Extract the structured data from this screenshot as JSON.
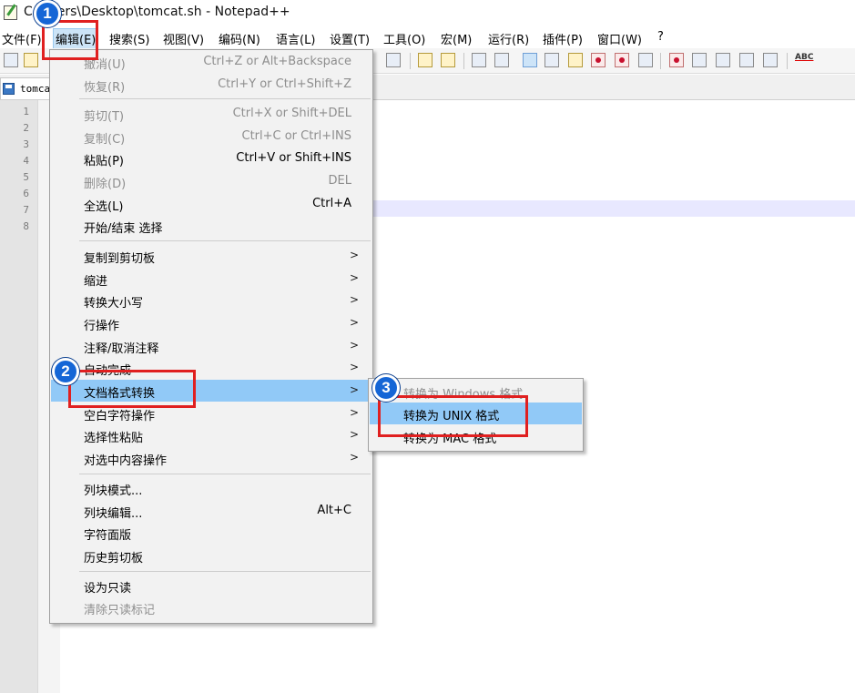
{
  "window": {
    "title": "C:\\Users\\Desktop\\tomcat.sh - Notepad++"
  },
  "menubar": [
    {
      "label": "文件(F)"
    },
    {
      "label": "编辑(E)"
    },
    {
      "label": "搜索(S)"
    },
    {
      "label": "视图(V)"
    },
    {
      "label": "编码(N)"
    },
    {
      "label": "语言(L)"
    },
    {
      "label": "设置(T)"
    },
    {
      "label": "工具(O)"
    },
    {
      "label": "宏(M)"
    },
    {
      "label": "运行(R)"
    },
    {
      "label": "插件(P)"
    },
    {
      "label": "窗口(W)"
    },
    {
      "label": "?"
    }
  ],
  "tab": {
    "label": "tomcat.sh"
  },
  "line_numbers": [
    "1",
    "2",
    "3",
    "4",
    "5",
    "6",
    "7",
    "8"
  ],
  "edit_menu": {
    "items": [
      {
        "label": "撤消(U)",
        "shortcut": "Ctrl+Z or Alt+Backspace"
      },
      {
        "label": "恢复(R)",
        "shortcut": "Ctrl+Y or Ctrl+Shift+Z"
      },
      {
        "label": "剪切(T)",
        "shortcut": "Ctrl+X or Shift+DEL"
      },
      {
        "label": "复制(C)",
        "shortcut": "Ctrl+C or Ctrl+INS"
      },
      {
        "label": "粘贴(P)",
        "shortcut": "Ctrl+V or Shift+INS"
      },
      {
        "label": "删除(D)",
        "shortcut": "DEL"
      },
      {
        "label": "全选(L)",
        "shortcut": "Ctrl+A"
      },
      {
        "label": "开始/结束 选择",
        "shortcut": ""
      },
      {
        "label": "复制到剪切板",
        "shortcut": ""
      },
      {
        "label": "缩进",
        "shortcut": ""
      },
      {
        "label": "转换大小写",
        "shortcut": ""
      },
      {
        "label": "行操作",
        "shortcut": ""
      },
      {
        "label": "注释/取消注释",
        "shortcut": ""
      },
      {
        "label": "自动完成",
        "shortcut": ""
      },
      {
        "label": "文档格式转换",
        "shortcut": ""
      },
      {
        "label": "空白字符操作",
        "shortcut": ""
      },
      {
        "label": "选择性粘贴",
        "shortcut": ""
      },
      {
        "label": "对选中内容操作",
        "shortcut": ""
      },
      {
        "label": "列块模式...",
        "shortcut": ""
      },
      {
        "label": "列块编辑...",
        "shortcut": "Alt+C"
      },
      {
        "label": "字符面版",
        "shortcut": ""
      },
      {
        "label": "历史剪切板",
        "shortcut": ""
      },
      {
        "label": "设为只读",
        "shortcut": ""
      },
      {
        "label": "清除只读标记",
        "shortcut": ""
      }
    ],
    "submenu_arrow": ">"
  },
  "format_submenu": {
    "items": [
      {
        "label": "转换为 Windows 格式"
      },
      {
        "label": "转换为 UNIX 格式"
      },
      {
        "label": "转换为 MAC 格式"
      }
    ]
  },
  "annotations": {
    "step1": "1",
    "step2": "2",
    "step3": "3",
    "color": "#e02020",
    "badge_color": "#1566d6"
  }
}
